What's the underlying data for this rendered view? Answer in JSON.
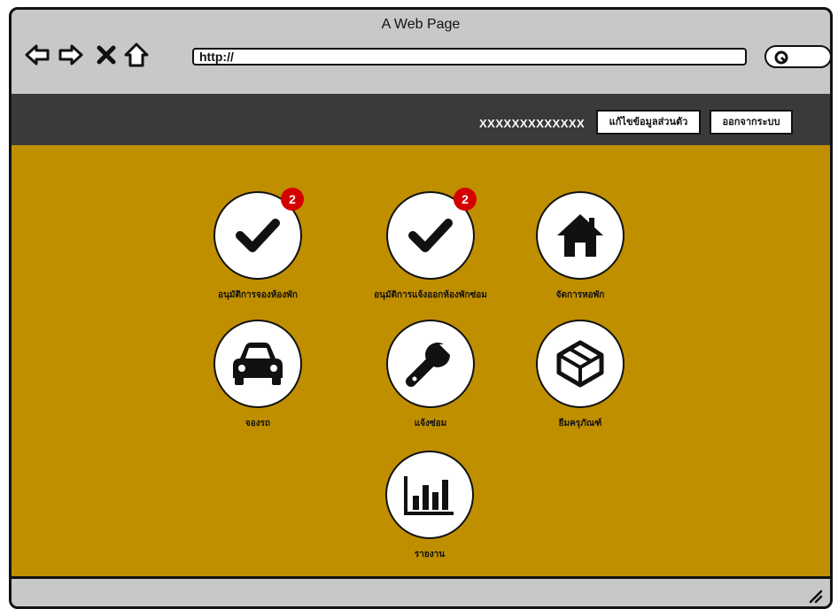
{
  "browser": {
    "title": "A Web Page",
    "url": "http://",
    "nav_icons": [
      "back-arrow-icon",
      "forward-arrow-icon",
      "close-icon",
      "home-icon"
    ],
    "search_icon": "search-icon"
  },
  "header": {
    "username": "XXXXXXXXXXXXX",
    "edit_profile_label": "แก้ไขข้อมูลส่วนตัว",
    "logout_label": "ออกจากระบบ"
  },
  "tiles": [
    {
      "label": "อนุมัติการจองห้องพัก",
      "icon": "check-icon",
      "badge": "2"
    },
    {
      "label": "อนุมัติการแจ้งออกห้องพักซ่อม",
      "icon": "check-icon",
      "badge": "2"
    },
    {
      "label": "จัดการหอพัก",
      "icon": "home-icon",
      "badge": ""
    },
    {
      "label": "จองรถ",
      "icon": "car-icon",
      "badge": ""
    },
    {
      "label": "แจ้งซ่อม",
      "icon": "wrench-icon",
      "badge": ""
    },
    {
      "label": "ยืมครุภัณฑ์",
      "icon": "box-icon",
      "badge": ""
    },
    {
      "label": "รายงาน",
      "icon": "bar-chart-icon",
      "badge": ""
    }
  ],
  "colors": {
    "content_bg": "#c08f00",
    "header_bg": "#3a3a3a",
    "badge": "#d40000"
  }
}
